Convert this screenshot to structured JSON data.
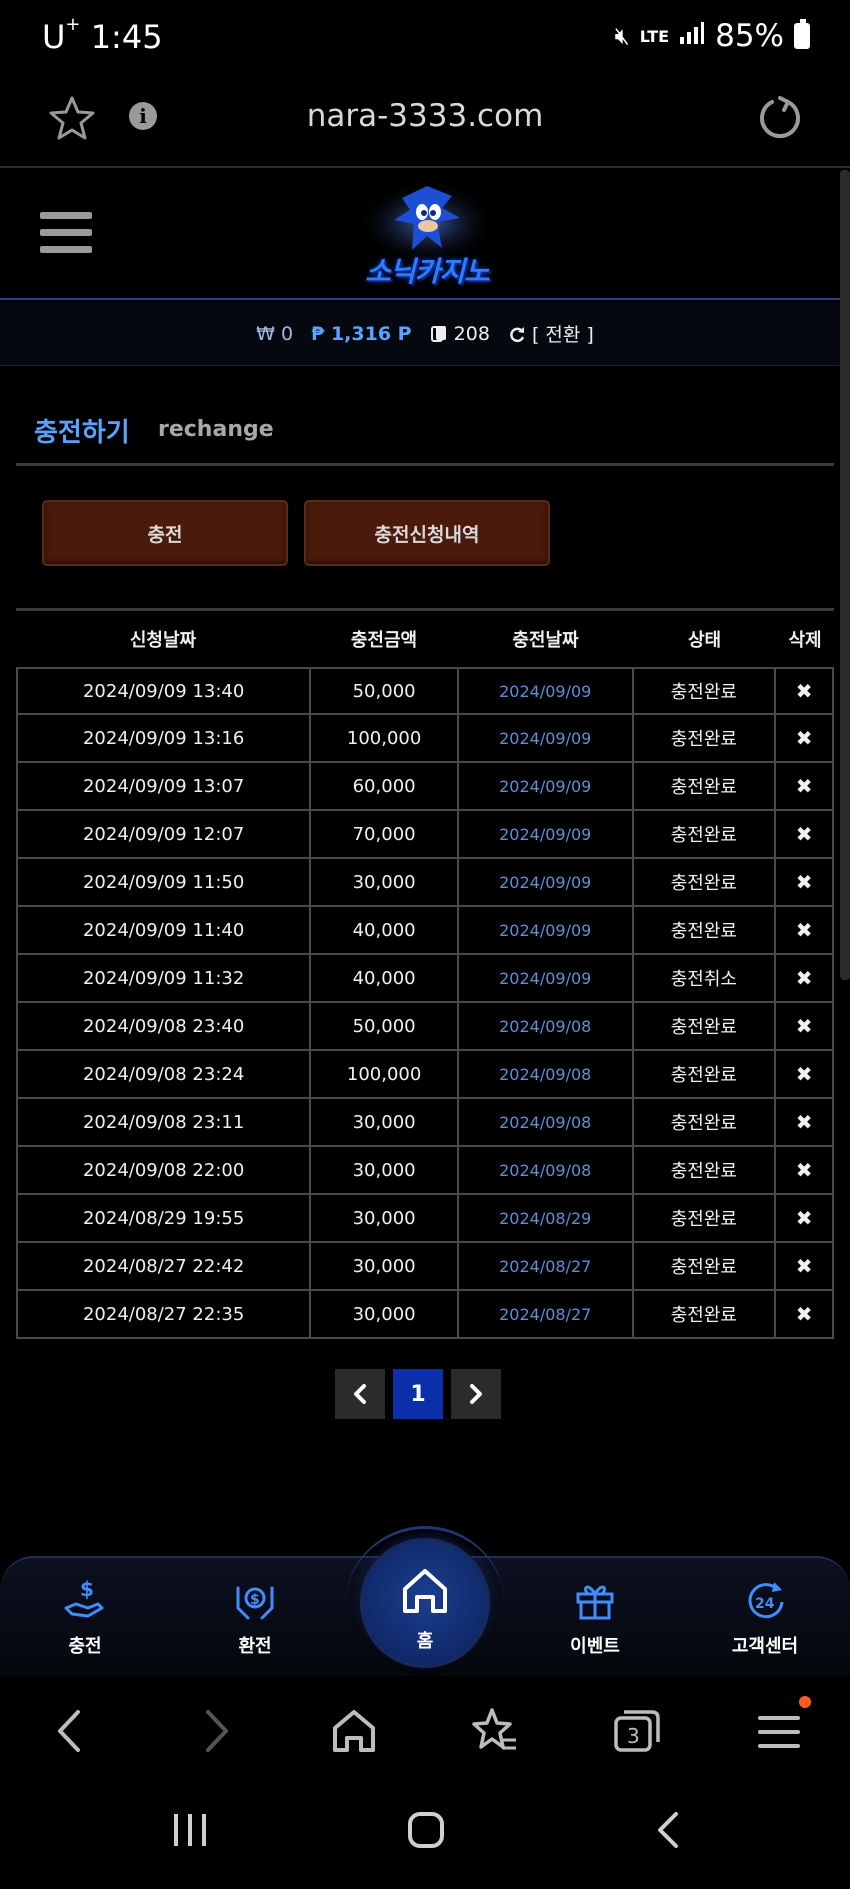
{
  "status_bar": {
    "carrier": "U",
    "carrier_sup": "+",
    "time": "1:45",
    "network": "LTE",
    "battery": "85%"
  },
  "browser": {
    "url": "nara-3333.com"
  },
  "site": {
    "logo_text": "소닉카지노"
  },
  "balance": {
    "won_symbol": "₩",
    "won": "0",
    "point_symbol": "₱",
    "point": "1,316 P",
    "chip": "208",
    "switch_label": "[ 전환 ]"
  },
  "page": {
    "title": "충전하기",
    "subtitle": "rechange"
  },
  "tabs": [
    {
      "label": "충전"
    },
    {
      "label": "충전신청내역"
    }
  ],
  "table": {
    "headers": [
      "신청날짜",
      "충전금액",
      "충전날짜",
      "상태",
      "삭제"
    ],
    "rows": [
      {
        "requested": "2024/09/09 13:40",
        "amount": "50,000",
        "date": "2024/09/09",
        "status": "충전완료",
        "delete": "✖"
      },
      {
        "requested": "2024/09/09 13:16",
        "amount": "100,000",
        "date": "2024/09/09",
        "status": "충전완료",
        "delete": "✖"
      },
      {
        "requested": "2024/09/09 13:07",
        "amount": "60,000",
        "date": "2024/09/09",
        "status": "충전완료",
        "delete": "✖"
      },
      {
        "requested": "2024/09/09 12:07",
        "amount": "70,000",
        "date": "2024/09/09",
        "status": "충전완료",
        "delete": "✖"
      },
      {
        "requested": "2024/09/09 11:50",
        "amount": "30,000",
        "date": "2024/09/09",
        "status": "충전완료",
        "delete": "✖"
      },
      {
        "requested": "2024/09/09 11:40",
        "amount": "40,000",
        "date": "2024/09/09",
        "status": "충전완료",
        "delete": "✖"
      },
      {
        "requested": "2024/09/09 11:32",
        "amount": "40,000",
        "date": "2024/09/09",
        "status": "충전취소",
        "delete": "✖"
      },
      {
        "requested": "2024/09/08 23:40",
        "amount": "50,000",
        "date": "2024/09/08",
        "status": "충전완료",
        "delete": "✖"
      },
      {
        "requested": "2024/09/08 23:24",
        "amount": "100,000",
        "date": "2024/09/08",
        "status": "충전완료",
        "delete": "✖"
      },
      {
        "requested": "2024/09/08 23:11",
        "amount": "30,000",
        "date": "2024/09/08",
        "status": "충전완료",
        "delete": "✖"
      },
      {
        "requested": "2024/09/08 22:00",
        "amount": "30,000",
        "date": "2024/09/08",
        "status": "충전완료",
        "delete": "✖"
      },
      {
        "requested": "2024/08/29 19:55",
        "amount": "30,000",
        "date": "2024/08/29",
        "status": "충전완료",
        "delete": "✖"
      },
      {
        "requested": "2024/08/27 22:42",
        "amount": "30,000",
        "date": "2024/08/27",
        "status": "충전완료",
        "delete": "✖"
      },
      {
        "requested": "2024/08/27 22:35",
        "amount": "30,000",
        "date": "2024/08/27",
        "status": "충전완료",
        "delete": "✖"
      }
    ]
  },
  "pagination": {
    "prev": "‹",
    "current": "1",
    "next": "›"
  },
  "bottom_nav": {
    "items": [
      {
        "label": "충전",
        "icon": "deposit-icon"
      },
      {
        "label": "환전",
        "icon": "exchange-icon"
      },
      {
        "label": "홈",
        "icon": "home-icon"
      },
      {
        "label": "이벤트",
        "icon": "gift-icon"
      },
      {
        "label": "고객센터",
        "icon": "support-24-icon"
      }
    ]
  },
  "colors": {
    "accent_blue": "#5aa2ff",
    "tab_button": "#4a1a0c",
    "active_page": "#0a2fa8",
    "date_text": "#5d8fd8"
  }
}
